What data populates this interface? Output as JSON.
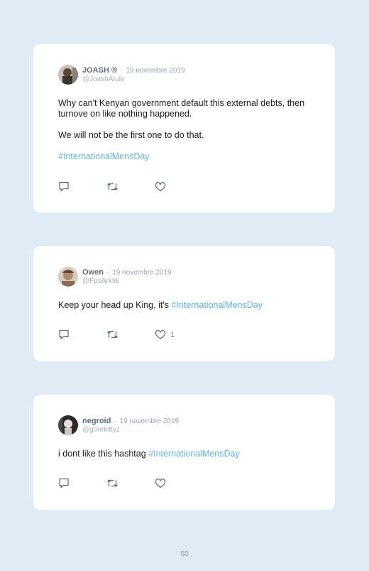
{
  "tweets": [
    {
      "name": "JOASH ®",
      "separator": "·",
      "date": "19 novembre 2019",
      "handle": "@JoashAtulo",
      "p1": "Why can't Kenyan government default this external debts, then turnove on like nothing happened.",
      "p2": "We will not be the first one to do that.",
      "hashtag": "#InternationalMensDay"
    },
    {
      "name": "Owen",
      "separator": "·",
      "date": "19 novembre 2019",
      "handle": "@FpsArktik",
      "text": "Keep your head up King, it's",
      "hashtag": "#InternationalMensDay",
      "likes": "1"
    },
    {
      "name": "negroid",
      "separator": "·",
      "date": "19 novembre 2019",
      "handle": "@gorekittyz",
      "text": "i dont like this hashtag",
      "hashtag": "#InternationalMensDay"
    }
  ],
  "page_number": "50",
  "colors": {
    "background": "#e0ecf5",
    "card": "#ffffff",
    "hashtag": "#62b3e0",
    "icon": "#5a6675"
  },
  "icons": [
    "reply-icon",
    "retweet-icon",
    "like-icon"
  ]
}
